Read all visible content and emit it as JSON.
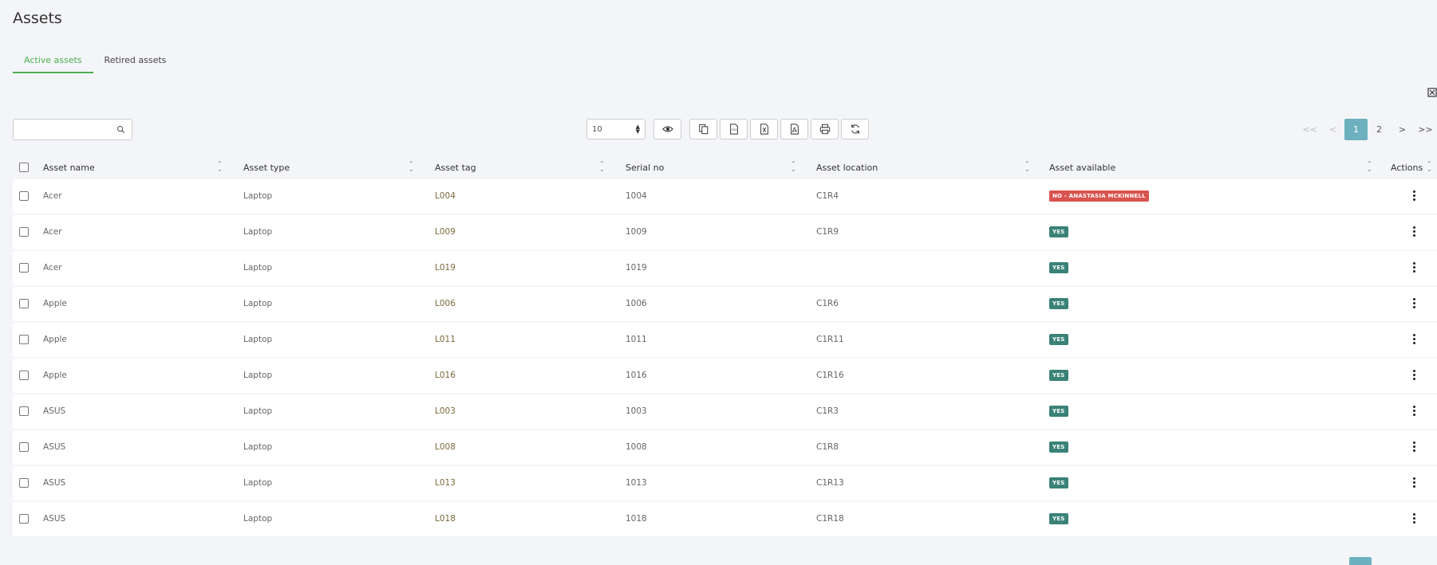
{
  "page": {
    "title": "Assets"
  },
  "tabs": [
    {
      "label": "Active assets",
      "active": true
    },
    {
      "label": "Retired assets",
      "active": false
    }
  ],
  "toolbar": {
    "search_placeholder": "",
    "page_size": "10",
    "buttons": [
      "eye-icon",
      "copy-icon",
      "csv-icon",
      "excel-icon",
      "pdf-icon",
      "print-icon",
      "refresh-icon"
    ]
  },
  "pagination": {
    "first": "<<",
    "prev": "<",
    "pages": [
      "1",
      "2"
    ],
    "current": "1",
    "next": ">",
    "last": ">>"
  },
  "table": {
    "columns": [
      "Asset name",
      "Asset type",
      "Asset tag",
      "Serial no",
      "Asset location",
      "Asset available",
      "Actions"
    ],
    "rows": [
      {
        "name": "Acer",
        "type": "Laptop",
        "tag": "L004",
        "serial": "1004",
        "location": "C1R4",
        "available": "NO - ANASTASIA MCKINNELL",
        "status": "no"
      },
      {
        "name": "Acer",
        "type": "Laptop",
        "tag": "L009",
        "serial": "1009",
        "location": "C1R9",
        "available": "YES",
        "status": "yes"
      },
      {
        "name": "Acer",
        "type": "Laptop",
        "tag": "L019",
        "serial": "1019",
        "location": "",
        "available": "YES",
        "status": "yes"
      },
      {
        "name": "Apple",
        "type": "Laptop",
        "tag": "L006",
        "serial": "1006",
        "location": "C1R6",
        "available": "YES",
        "status": "yes"
      },
      {
        "name": "Apple",
        "type": "Laptop",
        "tag": "L011",
        "serial": "1011",
        "location": "C1R11",
        "available": "YES",
        "status": "yes"
      },
      {
        "name": "Apple",
        "type": "Laptop",
        "tag": "L016",
        "serial": "1016",
        "location": "C1R16",
        "available": "YES",
        "status": "yes"
      },
      {
        "name": "ASUS",
        "type": "Laptop",
        "tag": "L003",
        "serial": "1003",
        "location": "C1R3",
        "available": "YES",
        "status": "yes"
      },
      {
        "name": "ASUS",
        "type": "Laptop",
        "tag": "L008",
        "serial": "1008",
        "location": "C1R8",
        "available": "YES",
        "status": "yes"
      },
      {
        "name": "ASUS",
        "type": "Laptop",
        "tag": "L013",
        "serial": "1013",
        "location": "C1R13",
        "available": "YES",
        "status": "yes"
      },
      {
        "name": "ASUS",
        "type": "Laptop",
        "tag": "L018",
        "serial": "1018",
        "location": "C1R18",
        "available": "YES",
        "status": "yes"
      }
    ]
  },
  "colors": {
    "accent": "#4caf50",
    "pager_active": "#6db1c0",
    "badge_yes": "#3a8278",
    "badge_no": "#d9534f"
  }
}
